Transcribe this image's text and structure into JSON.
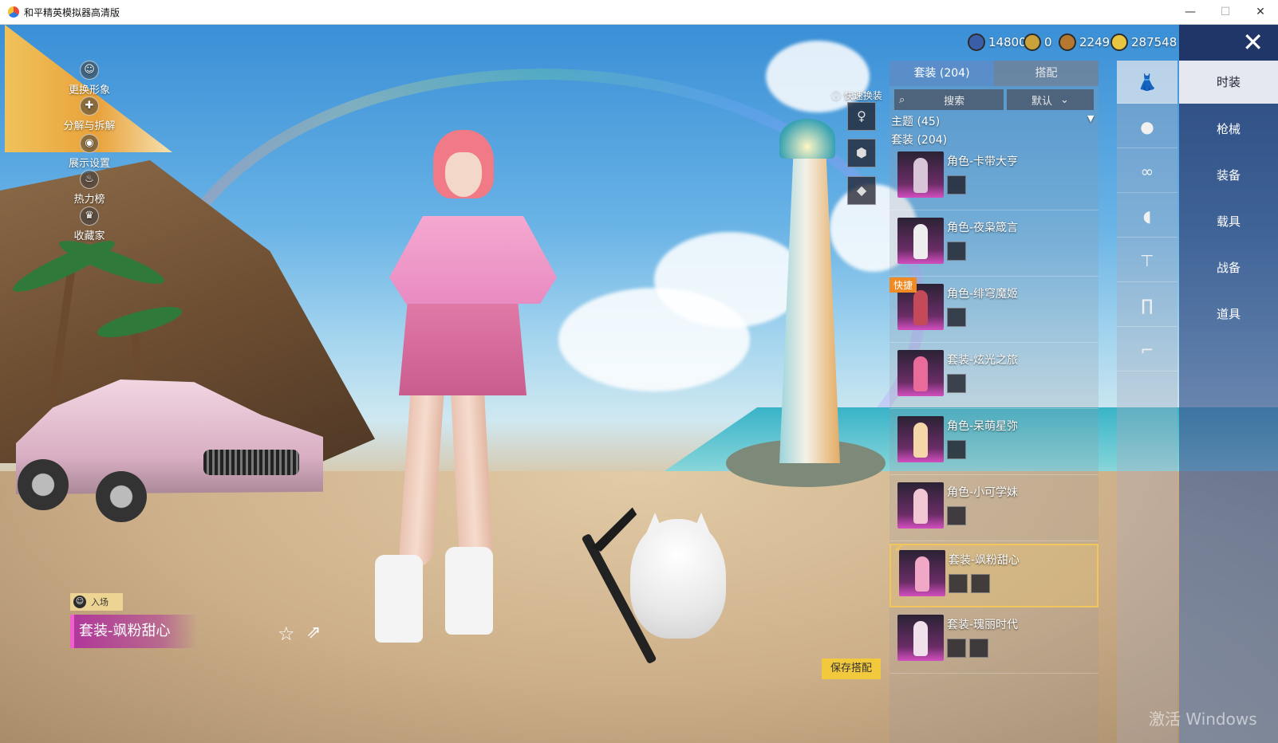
{
  "window": {
    "title": "和平精英模拟器高清版",
    "minimize": "—",
    "maximize": "☐",
    "close": "✕"
  },
  "left_menu": [
    {
      "label": "更换形象",
      "icon": "person-icon"
    },
    {
      "label": "分解与拆解",
      "icon": "puzzle-icon"
    },
    {
      "label": "展示设置",
      "icon": "eye-icon"
    },
    {
      "label": "热力榜",
      "icon": "flame-icon"
    },
    {
      "label": "收藏家",
      "icon": "collector-icon"
    }
  ],
  "currencies": [
    {
      "value": "14800",
      "icon": "blue-coin-icon",
      "color": "#3b5ea8"
    },
    {
      "value": "0",
      "icon": "gold-a-coin-icon",
      "color": "#c9a23a"
    },
    {
      "value": "2249",
      "icon": "bronze-coin-icon",
      "color": "#b5782e"
    },
    {
      "value": "287548",
      "icon": "gold-coin-icon",
      "color": "#e8c443"
    }
  ],
  "quick_change": {
    "label": "快速换装"
  },
  "panel": {
    "tabs": [
      {
        "label": "套装 (204)",
        "active": true
      },
      {
        "label": "搭配",
        "active": false
      }
    ],
    "search_label": "搜索",
    "sort_label": "默认",
    "section_theme": "主题 (45)",
    "section_sets": "套装 (204)",
    "items": [
      {
        "name": "角色-卡带大亨",
        "badge": "",
        "selected": false,
        "minis": 1
      },
      {
        "name": "角色-夜枭箴言",
        "badge": "",
        "selected": false,
        "minis": 1
      },
      {
        "name": "角色-绯穹魔姬",
        "badge": "快捷",
        "selected": false,
        "minis": 1
      },
      {
        "name": "套装-炫光之旅",
        "badge": "",
        "selected": false,
        "minis": 1
      },
      {
        "name": "角色-呆萌星弥",
        "badge": "",
        "selected": false,
        "minis": 1
      },
      {
        "name": "角色-小可学妹",
        "badge": "",
        "selected": false,
        "minis": 1
      },
      {
        "name": "套装-飒粉甜心",
        "badge": "",
        "selected": true,
        "minis": 2
      },
      {
        "name": "套装-瑰丽时代",
        "badge": "",
        "selected": false,
        "minis": 2
      }
    ]
  },
  "category_icons": [
    {
      "icon": "outfit-icon",
      "active": true
    },
    {
      "icon": "glove-icon",
      "active": false
    },
    {
      "icon": "glasses-icon",
      "active": false
    },
    {
      "icon": "mask-icon",
      "active": false
    },
    {
      "icon": "shirt-icon",
      "active": false
    },
    {
      "icon": "pants-icon",
      "active": false
    },
    {
      "icon": "shoes-icon",
      "active": false
    }
  ],
  "categories": [
    {
      "label": "时装",
      "active": true
    },
    {
      "label": "枪械",
      "active": false
    },
    {
      "label": "装备",
      "active": false
    },
    {
      "label": "载具",
      "active": false
    },
    {
      "label": "战备",
      "active": false
    },
    {
      "label": "道具",
      "active": false
    }
  ],
  "outfit": {
    "entry_tag": "入场",
    "name": "套装-飒粉甜心"
  },
  "save_button": "保存搭配",
  "watermark": "激活 Windows"
}
